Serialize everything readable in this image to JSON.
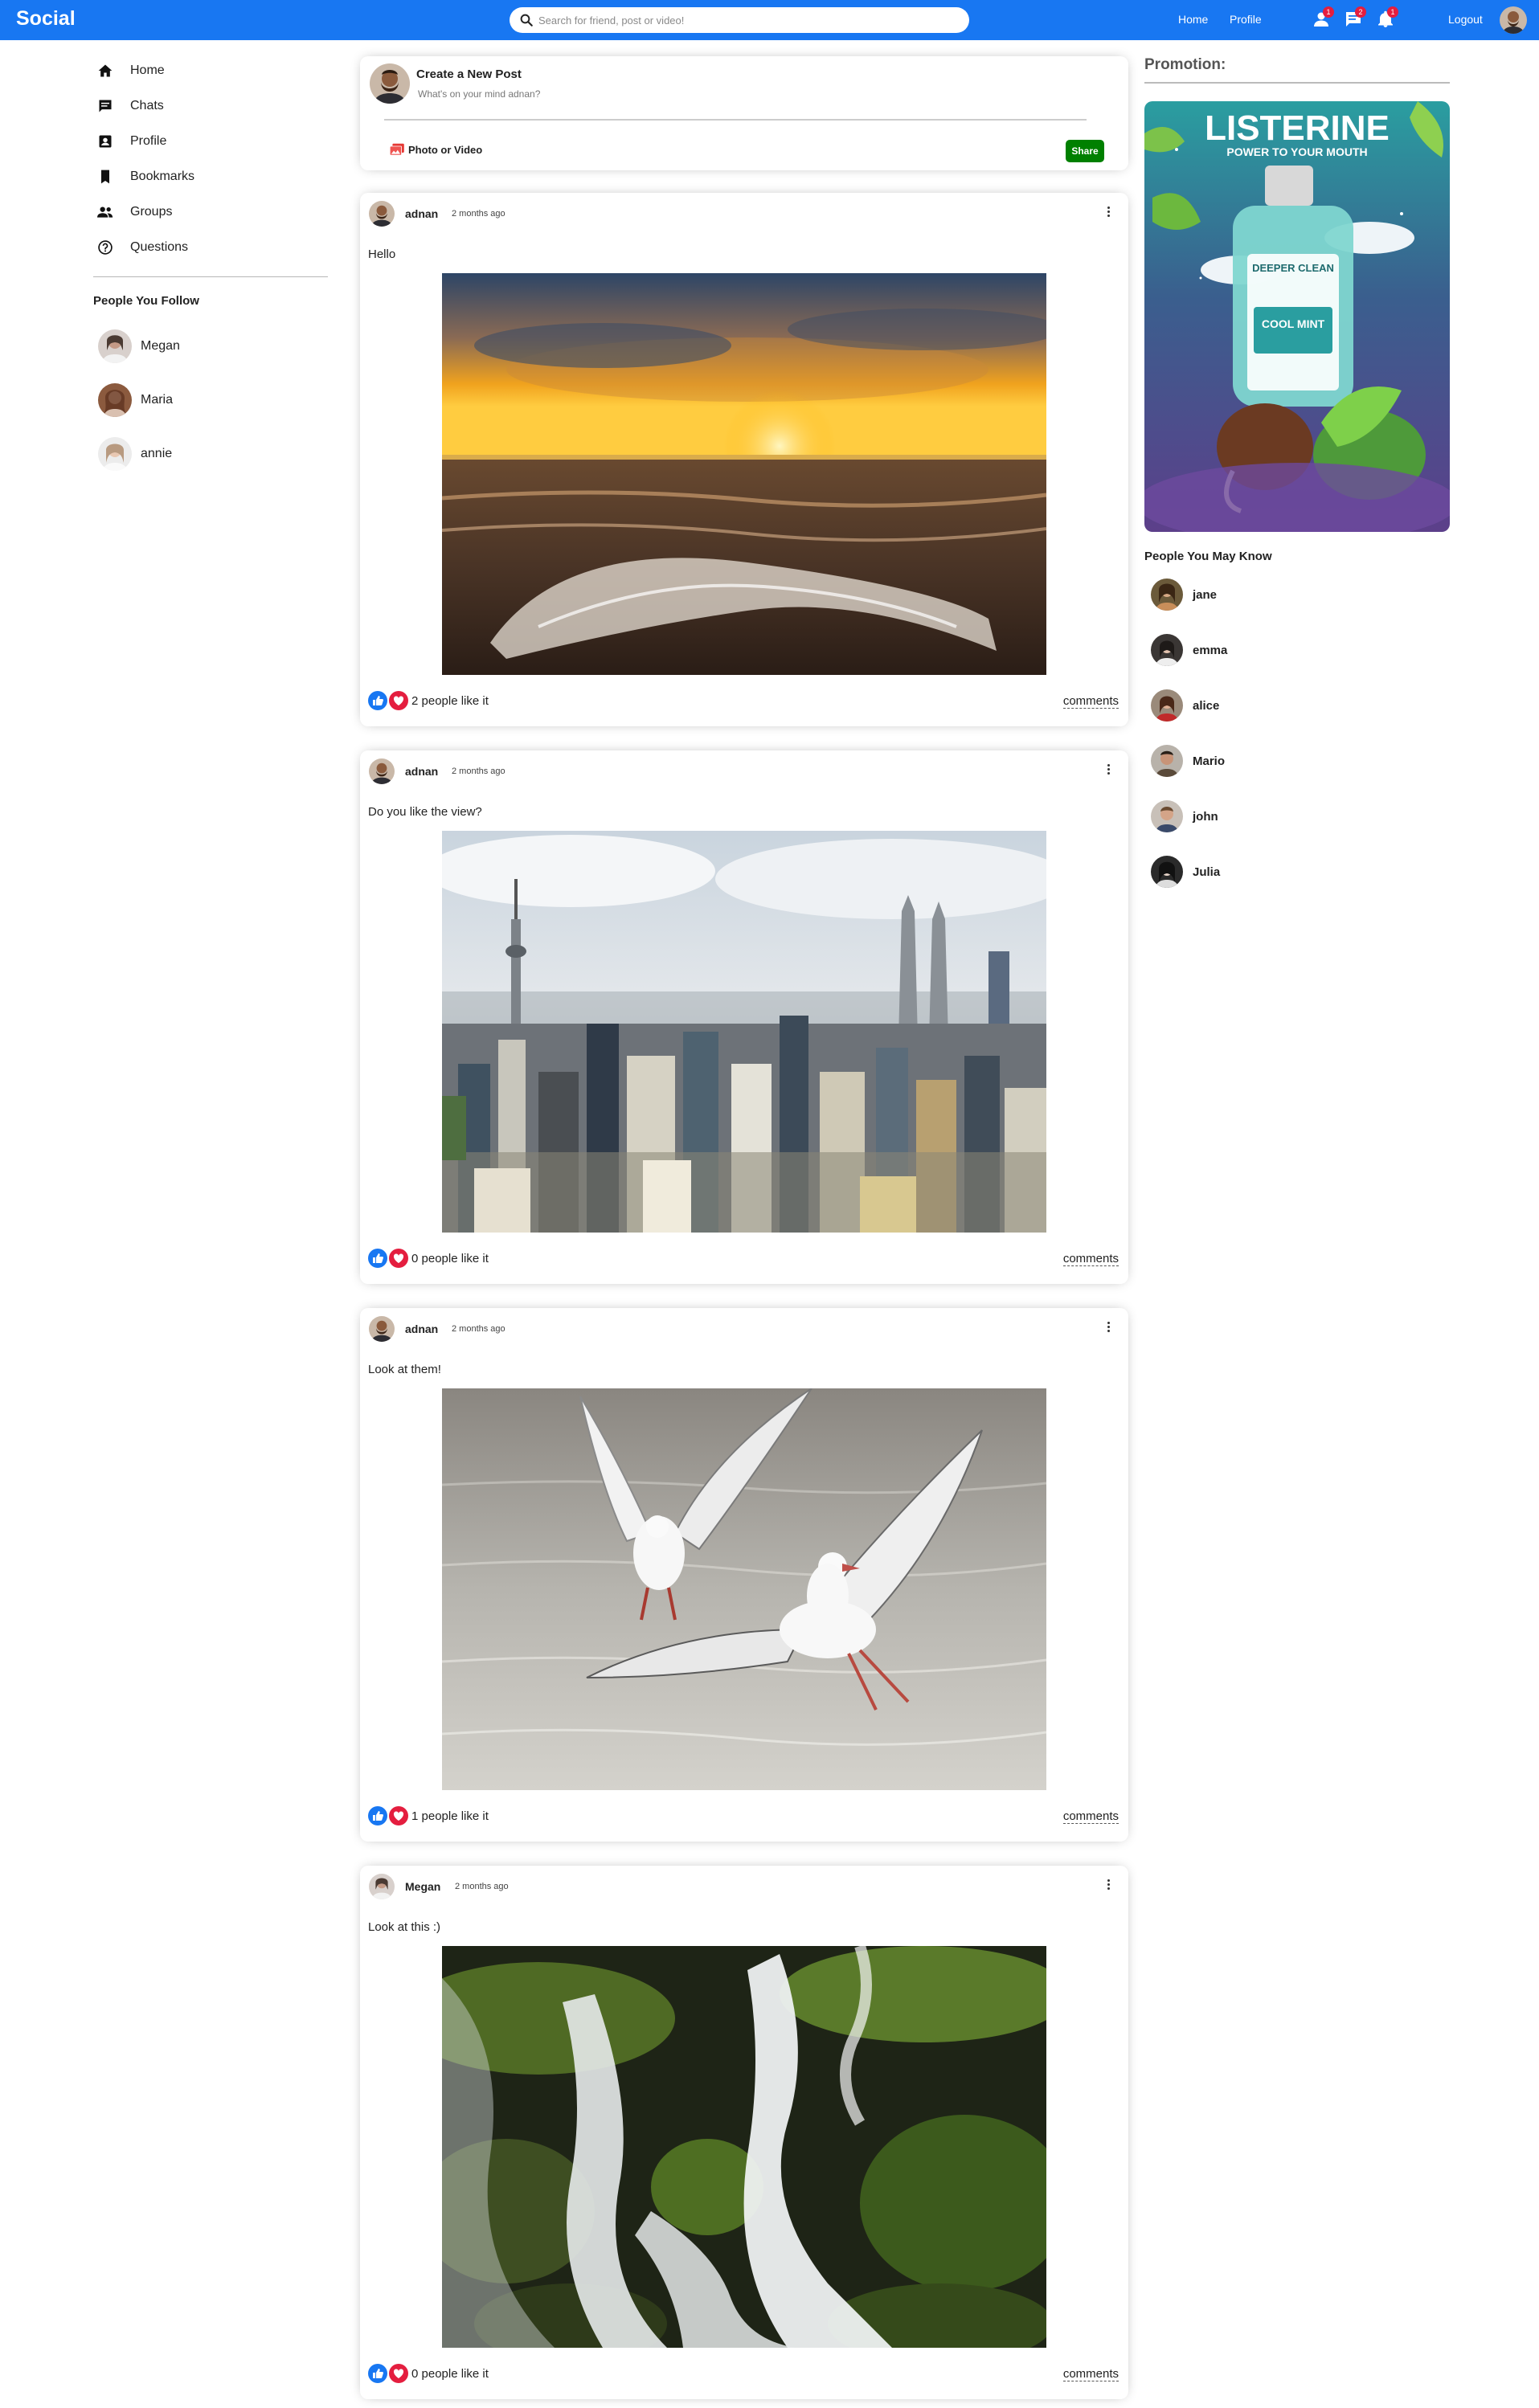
{
  "app": {
    "title": "Social"
  },
  "search": {
    "placeholder": "Search for friend, post or video!"
  },
  "nav": {
    "links": [
      "Home",
      "Profile"
    ],
    "badges": {
      "friends": "1",
      "messages": "2",
      "notifications": "1"
    },
    "logout": "Logout",
    "accent": "#1877f2"
  },
  "sidebar": {
    "items": [
      {
        "label": "Home",
        "icon": "home-icon"
      },
      {
        "label": "Chats",
        "icon": "chat-icon"
      },
      {
        "label": "Profile",
        "icon": "profile-icon"
      },
      {
        "label": "Bookmarks",
        "icon": "bookmark-icon"
      },
      {
        "label": "Groups",
        "icon": "groups-icon"
      },
      {
        "label": "Questions",
        "icon": "question-icon"
      }
    ],
    "following_title": "People You Follow",
    "following": [
      {
        "name": "Megan"
      },
      {
        "name": "Maria"
      },
      {
        "name": "annie"
      }
    ]
  },
  "share": {
    "title": "Create a New Post",
    "placeholder": "What's on your mind adnan?",
    "option": "Photo or Video",
    "button": "Share",
    "button_color": "#008000"
  },
  "posts": [
    {
      "user": "adnan",
      "date": "2 months ago",
      "text": "Hello",
      "likes": "2 people like it",
      "comments": "comments",
      "image": "sunset-beach"
    },
    {
      "user": "adnan",
      "date": "2 months ago",
      "text": "Do you like the view?",
      "likes": "0 people like it",
      "comments": "comments",
      "image": "city-skyline"
    },
    {
      "user": "adnan",
      "date": "2 months ago",
      "text": "Look at them!",
      "likes": "1 people like it",
      "comments": "comments",
      "image": "seagulls"
    },
    {
      "user": "Megan",
      "date": "2 months ago",
      "text": "Look at this :)",
      "likes": "0 people like it",
      "comments": "comments",
      "image": "waterfall"
    }
  ],
  "right": {
    "promo_title": "Promotion:",
    "ad": {
      "brand": "LISTERINE",
      "tagline": "POWER TO YOUR MOUTH",
      "product_line1": "DEEPER CLEAN",
      "product_line2": "COOL MINT"
    },
    "pymk_title": "People You May Know",
    "people": [
      {
        "name": "jane"
      },
      {
        "name": "emma"
      },
      {
        "name": "alice"
      },
      {
        "name": "Mario"
      },
      {
        "name": "john"
      },
      {
        "name": "Julia"
      }
    ]
  }
}
